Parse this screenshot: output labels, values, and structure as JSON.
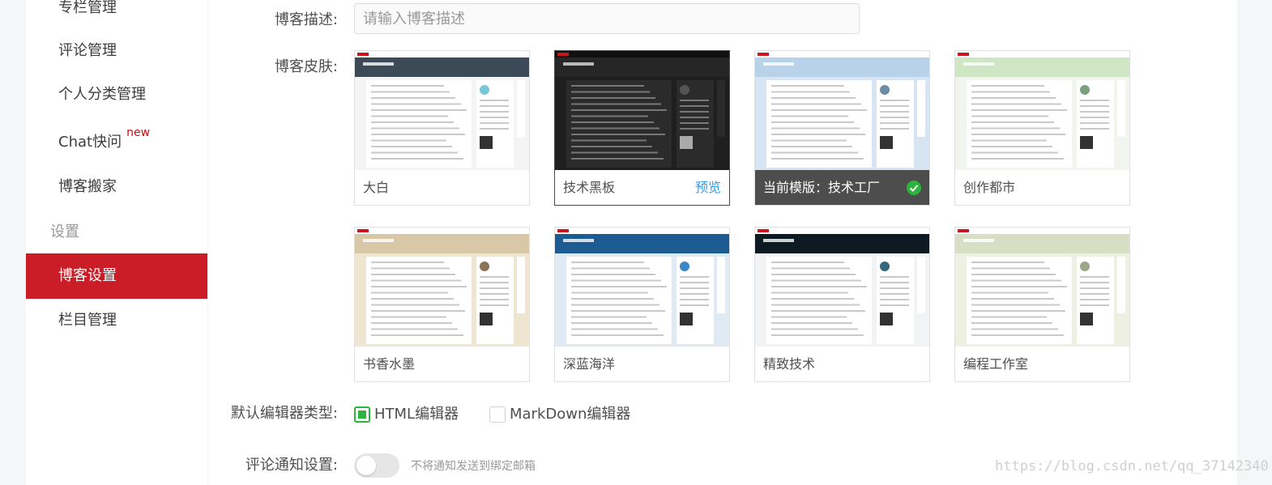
{
  "sidebar": {
    "items": [
      {
        "label": "专栏管理"
      },
      {
        "label": "评论管理"
      },
      {
        "label": "个人分类管理"
      },
      {
        "label": "Chat快问",
        "badge": "new"
      },
      {
        "label": "博客搬家"
      }
    ],
    "group_title": "设置",
    "settings_items": [
      {
        "label": "博客设置",
        "active": true
      },
      {
        "label": "栏目管理"
      }
    ]
  },
  "form": {
    "description_label": "博客描述:",
    "description_placeholder": "请输入博客描述",
    "skin_label": "博客皮肤:",
    "editor_label": "默认编辑器类型:",
    "comment_label": "评论通知设置:"
  },
  "skins": [
    {
      "name": "大白",
      "theme": "dabai"
    },
    {
      "name": "技术黑板",
      "theme": "heiban",
      "selected": true,
      "action": "预览"
    },
    {
      "name": "当前模版：技术工厂",
      "theme": "gongchang",
      "current": true
    },
    {
      "name": "创作都市",
      "theme": "dushi"
    },
    {
      "name": "书香水墨",
      "theme": "shuimo"
    },
    {
      "name": "深蓝海洋",
      "theme": "haiyang"
    },
    {
      "name": "精致技术",
      "theme": "jingzhi"
    },
    {
      "name": "编程工作室",
      "theme": "gongzuoshi"
    }
  ],
  "editor_options": [
    {
      "label": "HTML编辑器",
      "checked": true
    },
    {
      "label": "MarkDown编辑器",
      "checked": false
    }
  ],
  "comment_notify": {
    "enabled": false,
    "text": "不将通知发送到绑定邮箱"
  },
  "watermark": "https://blog.csdn.net/qq_37142340",
  "colors": {
    "accent": "#ca1d27",
    "preview_link": "#3399ea",
    "check_green": "#2db43c",
    "current_caption_bg": "#4d4d4d"
  }
}
